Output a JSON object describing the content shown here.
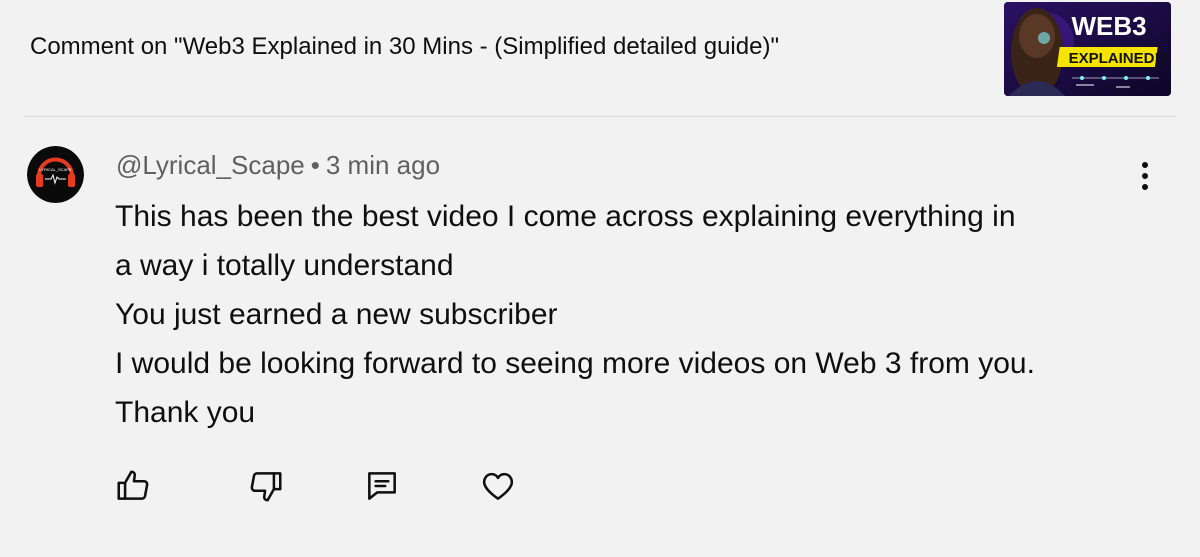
{
  "header": {
    "title": "Comment on \"Web3 Explained in 30 Mins - (Simplified detailed guide)\"",
    "thumbnail": {
      "line1": "WEB3",
      "line2": "EXPLAINED!!!"
    }
  },
  "comment": {
    "author": "@Lyrical_Scape",
    "separator": "•",
    "time": "3 min ago",
    "avatar_text": "LYRICAL_SCAPE",
    "lines": [
      "This has been the best video I come across explaining everything in",
      "a way i totally understand",
      "You just earned a new subscriber",
      "I would be looking forward to seeing more videos on Web 3 from you.",
      "Thank you"
    ]
  },
  "actions": {
    "icons": [
      "thumbs-up-icon",
      "thumbs-down-icon",
      "reply-icon",
      "heart-icon"
    ]
  },
  "colors": {
    "background": "#f2f2f2",
    "text_primary": "#0f0f0f",
    "text_secondary": "#606060",
    "thumbnail_accent": "#f5e400",
    "avatar_ring": "#e63b1f"
  }
}
